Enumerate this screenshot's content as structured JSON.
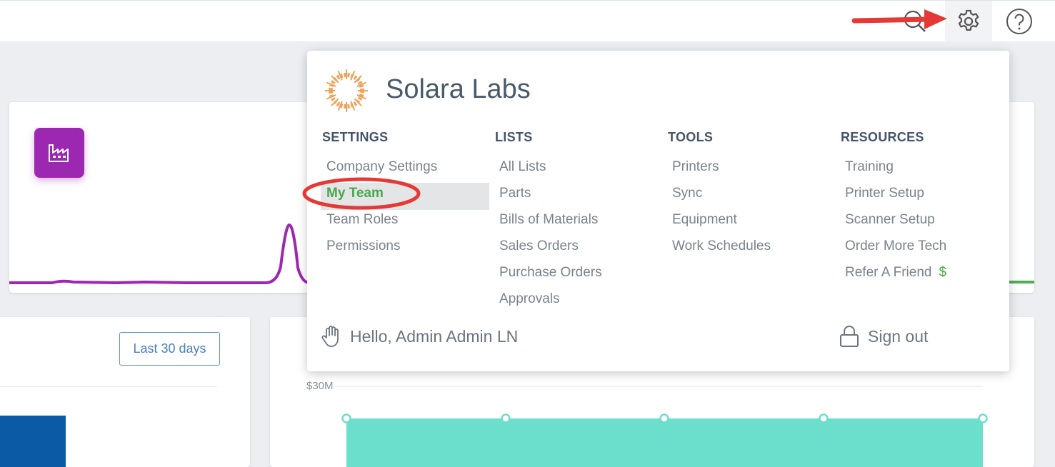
{
  "topbar": {
    "icons": [
      "search-icon",
      "gear-icon",
      "help-icon"
    ]
  },
  "company": {
    "name": "Solara Labs"
  },
  "menu": {
    "columns": [
      {
        "heading": "SETTINGS",
        "items": [
          "Company Settings",
          "My Team",
          "Team Roles",
          "Permissions"
        ]
      },
      {
        "heading": "LISTS",
        "items": [
          "All Lists",
          "Parts",
          "Bills of Materials",
          "Sales Orders",
          "Purchase Orders",
          "Approvals"
        ]
      },
      {
        "heading": "TOOLS",
        "items": [
          "Printers",
          "Sync",
          "Equipment",
          "Work Schedules"
        ]
      },
      {
        "heading": "RESOURCES",
        "items": [
          "Training",
          "Printer Setup",
          "Scanner Setup",
          "Order More Tech",
          "Refer A Friend"
        ]
      }
    ],
    "active_item": "My Team",
    "refer_symbol": "$"
  },
  "footer": {
    "greeting": "Hello, Admin Admin LN",
    "signout": "Sign out"
  },
  "background": {
    "date_range_button": "Last 30 days",
    "chart_axis_label": "$30M"
  },
  "colors": {
    "accent_green": "#49a84c",
    "tile_purple": "#9c27b0",
    "teal_fill": "#6bdfcb",
    "annotation_red": "#e53935"
  }
}
